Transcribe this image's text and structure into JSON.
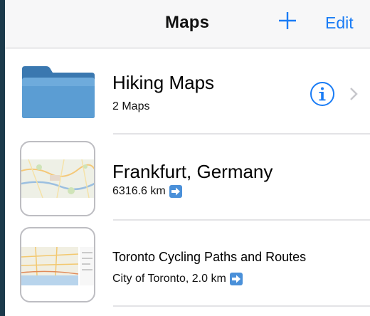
{
  "navbar": {
    "title": "Maps",
    "add_icon": "plus-icon",
    "edit_label": "Edit"
  },
  "colors": {
    "accent": "#1a7cf5",
    "folder": "#4a8bc4",
    "badge": "#4a90d9"
  },
  "items": [
    {
      "type": "folder",
      "icon": "folder-icon",
      "title": "Hiking Maps",
      "subtitle": "2 Maps",
      "accessory": [
        "info-icon",
        "chevron-right-icon"
      ]
    },
    {
      "type": "map",
      "icon": "map-thumbnail",
      "title": "Frankfurt, Germany",
      "subtitle": "6316.6 km",
      "badge_icon": "arrow-right-icon"
    },
    {
      "type": "map",
      "icon": "map-thumbnail",
      "title": "Toronto Cycling Paths and Routes",
      "subtitle": "City of Toronto, 2.0 km",
      "badge_icon": "arrow-right-icon"
    }
  ]
}
